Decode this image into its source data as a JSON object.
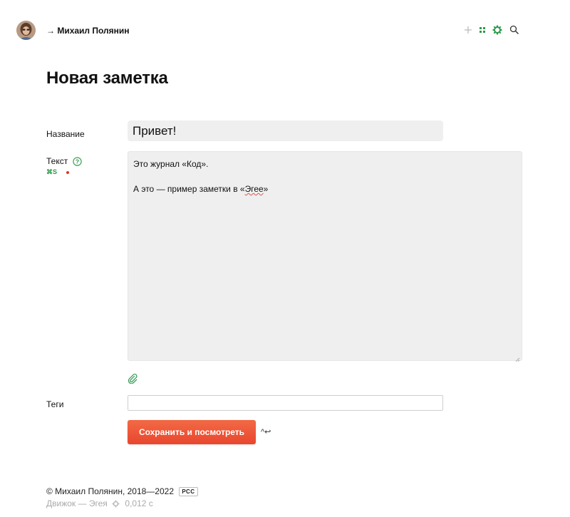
{
  "header": {
    "author_link": "→ Михаил Полянин",
    "icons": [
      "plus-icon",
      "grid-icon",
      "settings-gear-icon",
      "search-icon"
    ],
    "accent_green": "#2b9a4a"
  },
  "page": {
    "title": "Новая заметка"
  },
  "form": {
    "title_label": "Название",
    "title_value": "Привет!",
    "text_label": "Текст",
    "text_shortcut": "⌘S",
    "text_lines": [
      "Это журнал «Код».",
      "А это — пример заметки в «",
      "Эгее",
      "»"
    ],
    "tags_label": "Теги",
    "tags_value": "",
    "save_label": "Сохранить и посмотреть",
    "save_hint": "^↩",
    "button_color": "#ec5435"
  },
  "footer": {
    "copyright": "© Михаил Полянин, 2018—2022",
    "rss_label": "РСС",
    "engine": "Движок — Эгея",
    "timing": "0,012 с"
  }
}
